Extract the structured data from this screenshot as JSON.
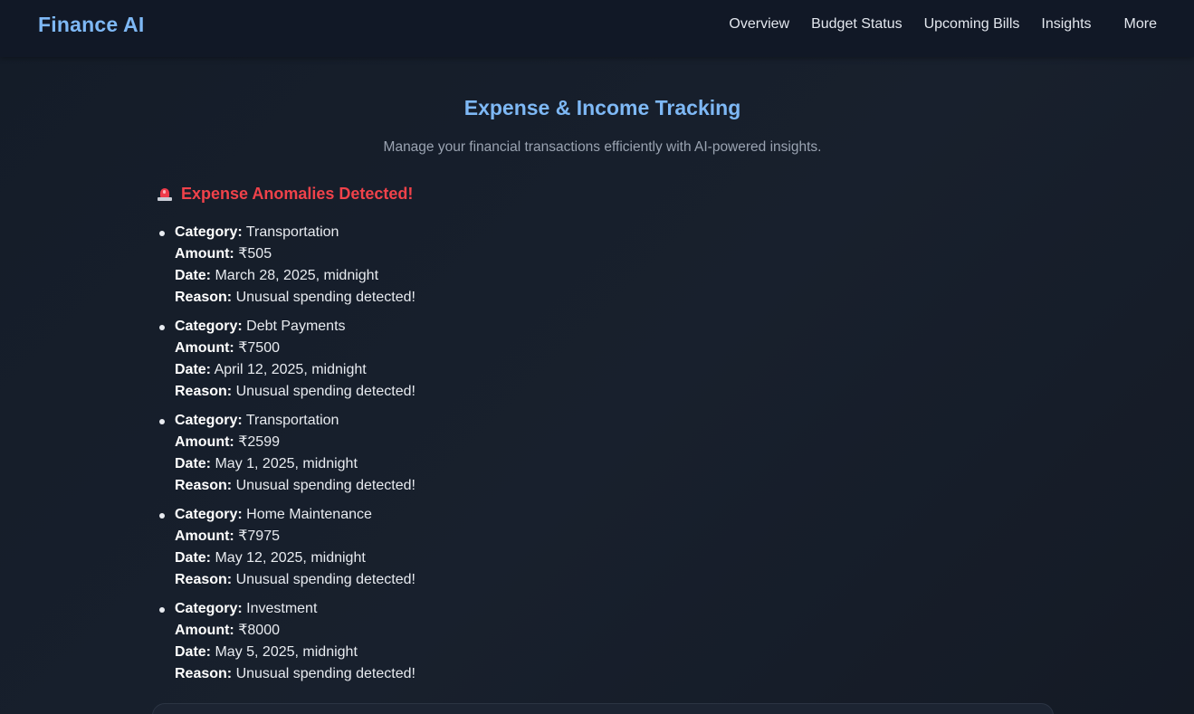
{
  "navbar": {
    "brand": "Finance AI",
    "links": [
      "Overview",
      "Budget Status",
      "Upcoming Bills",
      "Insights",
      "More"
    ]
  },
  "header": {
    "title": "Expense & Income Tracking",
    "subtitle": "Manage your financial transactions efficiently with AI-powered insights."
  },
  "anomalies": {
    "icon": "siren-icon",
    "title": "Expense Anomalies Detected!",
    "labels": {
      "category": "Category:",
      "amount": "Amount:",
      "date": "Date:",
      "reason": "Reason:"
    },
    "items": [
      {
        "category": "Transportation",
        "amount": "₹505",
        "date": "March 28, 2025, midnight",
        "reason": "Unusual spending detected!"
      },
      {
        "category": "Debt Payments",
        "amount": "₹7500",
        "date": "April 12, 2025, midnight",
        "reason": "Unusual spending detected!"
      },
      {
        "category": "Transportation",
        "amount": "₹2599",
        "date": "May 1, 2025, midnight",
        "reason": "Unusual spending detected!"
      },
      {
        "category": "Home Maintenance",
        "amount": "₹7975",
        "date": "May 12, 2025, midnight",
        "reason": "Unusual spending detected!"
      },
      {
        "category": "Investment",
        "amount": "₹8000",
        "date": "May 5, 2025, midnight",
        "reason": "Unusual spending detected!"
      }
    ]
  },
  "colors": {
    "background": "#141b27",
    "navbar": "#111826",
    "accent": "#7eb8f5",
    "alert": "#f0424a",
    "muted_text": "#9aa3b1"
  }
}
